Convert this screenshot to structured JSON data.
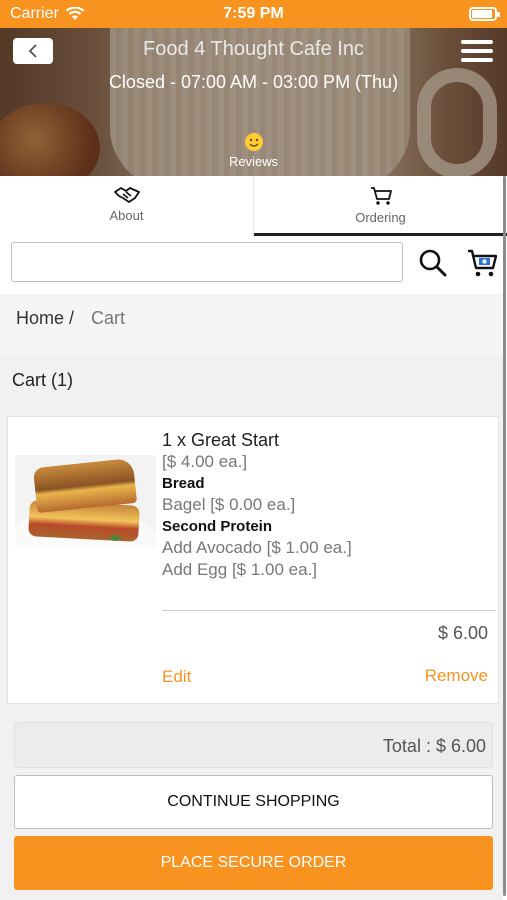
{
  "status_bar": {
    "carrier": "Carrier",
    "time": "7:59 PM"
  },
  "header": {
    "title": "Food 4 Thought Cafe Inc",
    "hours": "Closed - 07:00 AM - 03:00 PM (Thu)",
    "reviews_label": "Reviews"
  },
  "tabs": [
    {
      "label": "About",
      "icon": "handshake-icon",
      "active": false
    },
    {
      "label": "Ordering",
      "icon": "cart-icon",
      "active": true
    }
  ],
  "search": {
    "value": "",
    "placeholder": ""
  },
  "breadcrumb": {
    "home": "Home /",
    "current": "Cart"
  },
  "cart": {
    "title": "Cart (1)",
    "item": {
      "name": "1 x Great Start",
      "unit_price": "[$ 4.00 ea.]",
      "options": [
        {
          "heading": "Bread",
          "choices": [
            "Bagel [$ 0.00 ea.]"
          ]
        },
        {
          "heading": "Second Protein",
          "choices": [
            "Add Avocado [$ 1.00 ea.]",
            "Add Egg [$ 1.00 ea.]"
          ]
        }
      ],
      "line_total": "$ 6.00",
      "edit_label": "Edit",
      "remove_label": "Remove"
    },
    "total": "Total : $ 6.00",
    "continue_label": "CONTINUE SHOPPING",
    "order_label": "PLACE SECURE ORDER"
  },
  "colors": {
    "accent": "#f7931e",
    "text": "#222222",
    "muted": "#777777"
  }
}
